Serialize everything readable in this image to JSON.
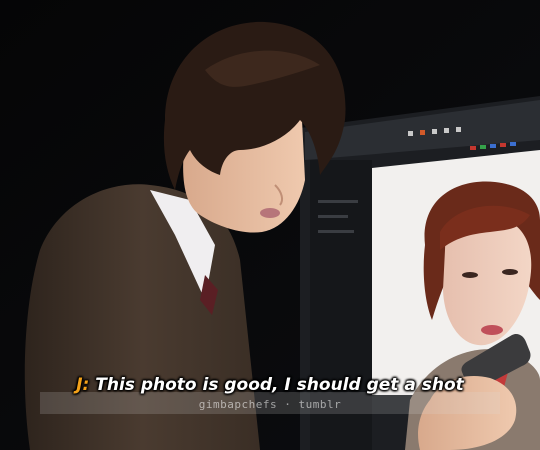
{
  "subtitle": {
    "speaker": "J:",
    "text": " This photo is good, I should get a shot"
  },
  "watermark": "gimbapchefs · tumblr",
  "colors": {
    "speaker": "#f4a21a",
    "subtitle_text": "#ffffff",
    "background": "#060607"
  }
}
